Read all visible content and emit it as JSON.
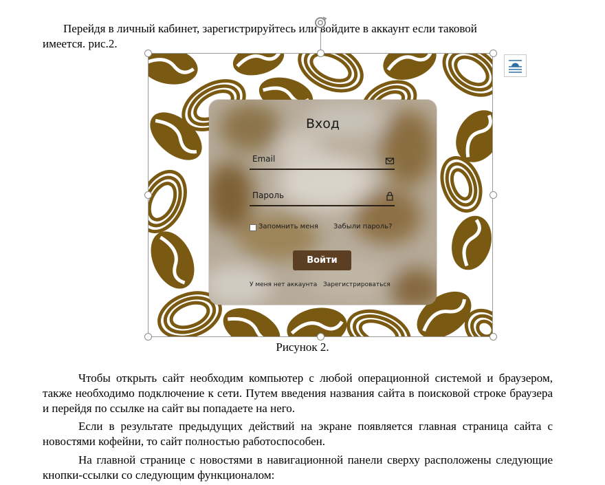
{
  "document": {
    "intro_line1": "Перейдя в личный кабинет, зарегистрируйтесь или войдите в аккаунт если таковой",
    "intro_line2": "имеется. рис.2.",
    "caption": "Рисунок 2.",
    "paragraph1": "Чтобы открыть сайт необходим компьютер с любой операционной системой и браузером, также необходимо подключение к сети. Путем введения названия сайта в поисковой строке браузера и перейдя по ссылке на сайт вы попадаете на него.",
    "paragraph2": "Если в результате предыдущих действий на экране появляется главная страница сайта с новостями кофейни, то сайт полностью работоспособен.",
    "paragraph3": "На главной странице с новостями в навигационной панели сверху расположены следующие кнопки-ссылки со следующим функционалом:"
  },
  "figure": {
    "login": {
      "title": "Вход",
      "email_label": "Email",
      "password_label": "Пароль",
      "remember_label": "Запомнить меня",
      "forgot_label": "Забыли пароль?",
      "button_label": "Войти",
      "no_account_label": "У меня нет аккаунта",
      "register_label": "Зарегистрироваться"
    },
    "colors": {
      "bean": "#7a5a12",
      "button": "#5c3f23",
      "card": "#b6ab9a"
    }
  },
  "icons": {
    "rotate": "rotate-icon",
    "layout_options": "layout-options-icon",
    "mail": "mail-icon",
    "lock": "lock-icon"
  }
}
